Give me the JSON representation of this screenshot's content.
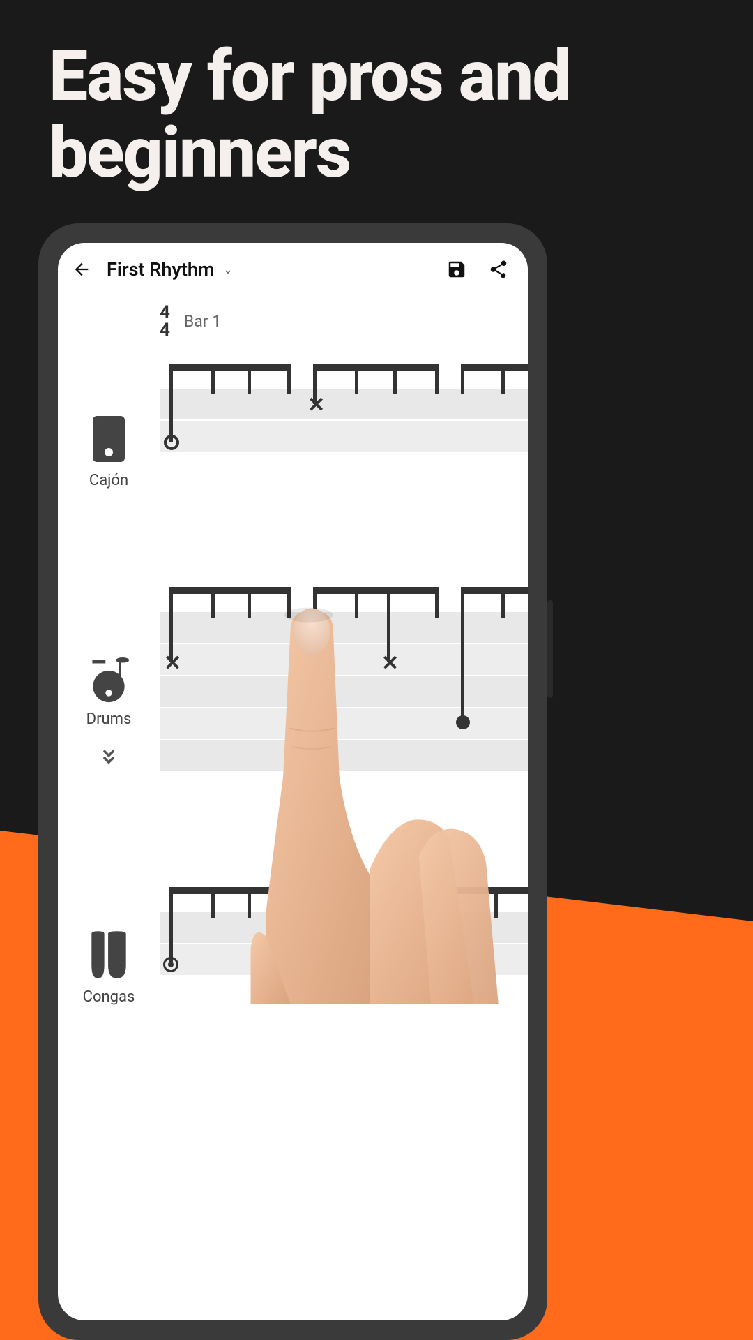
{
  "headline": "Easy for pros and beginners",
  "header": {
    "title": "First Rhythm",
    "save_label": "Save",
    "share_label": "Share"
  },
  "time_signature": {
    "top": "4",
    "bottom": "4"
  },
  "bar_label": "Bar 1",
  "instruments": [
    {
      "name": "Cajón",
      "icon": "cajon"
    },
    {
      "name": "Drums",
      "icon": "drums"
    },
    {
      "name": "Congas",
      "icon": "congas"
    }
  ]
}
